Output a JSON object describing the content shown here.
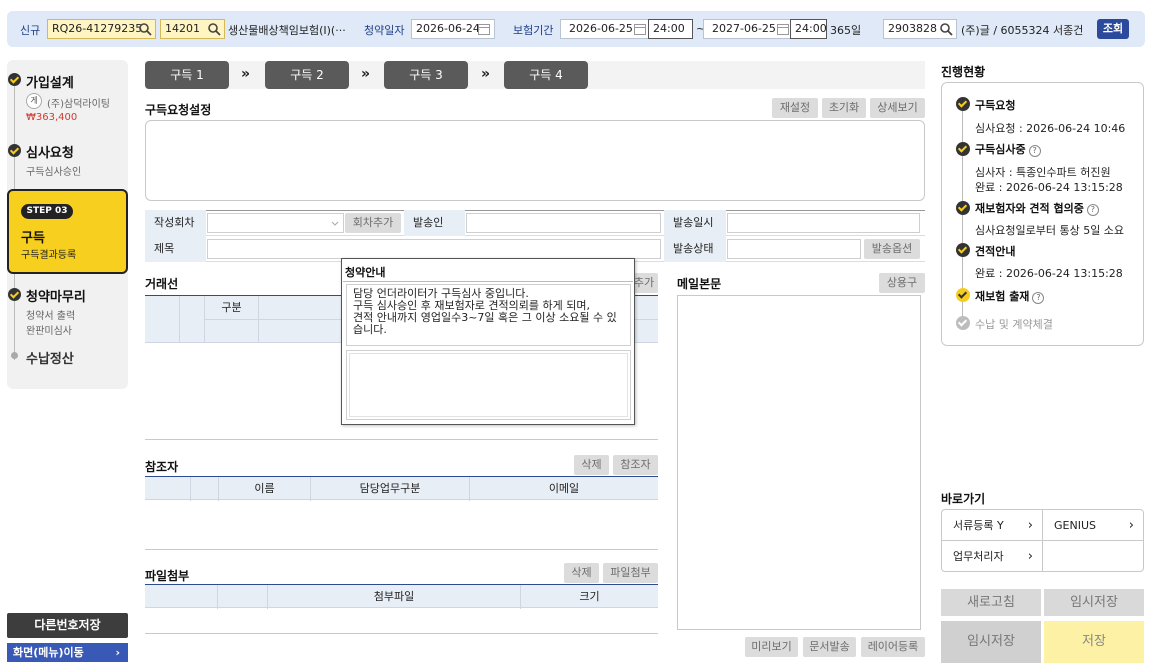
{
  "topbar": {
    "new_label": "신규",
    "case_no": "RQ26-41279235",
    "code": "14201",
    "product": "생산물배상책임보험(I)(···",
    "subscribe_date_label": "청약일자",
    "subscribe_date": "2026-06-24",
    "period_label": "보험기간",
    "period_start": "2026-06-25",
    "period_start_time": "24:00",
    "tilde": "~",
    "period_end": "2027-06-25",
    "period_end_time": "24:00",
    "days": "365일",
    "customer_code": "2903828",
    "customer_name": "(주)글 / 6055324 서종건",
    "query_button": "조회"
  },
  "steps": {
    "s1": {
      "title": "가입설계",
      "badge": "게",
      "company": "(주)삼덕라이팅",
      "amount": "₩363,400"
    },
    "s2": {
      "title": "심사요청",
      "sub": "구득심사승인"
    },
    "s3": {
      "badge": "STEP 03",
      "title": "구득",
      "sub": "구득결과등록"
    },
    "s4": {
      "title": "청약마무리",
      "sub1": "청약서 출력",
      "sub2": "완판미심사"
    },
    "s5": {
      "title": "수납정산"
    }
  },
  "left_buttons": {
    "save_other": "다른번호저장",
    "menu_move": "화면(메뉴)이동",
    "chevron": "›"
  },
  "tabs": [
    "구득 1",
    "구득 2",
    "구득 3",
    "구득 4"
  ],
  "tab_arrow": "»",
  "request": {
    "title": "구득요청설정",
    "buttons": [
      "재설정",
      "초기화",
      "상세보기"
    ]
  },
  "form": {
    "round_label": "작성회차",
    "add_round": "회차추가",
    "sender_label": "발송인",
    "send_date_label": "발송일시",
    "subject_label": "제목",
    "send_status_label": "발송상태",
    "send_option": "발송옵션"
  },
  "counterpart": {
    "title": "거래선",
    "add_button": "추가",
    "col_type": "구분"
  },
  "mail": {
    "title": "메일본문",
    "phrase_button": "상용구"
  },
  "reference": {
    "title": "참조자",
    "delete": "삭제",
    "add": "참조자",
    "cols": [
      "이름",
      "담당업무구분",
      "이메일"
    ]
  },
  "attach": {
    "title": "파일첨부",
    "delete": "삭제",
    "add": "파일첨부",
    "cols": [
      "첨부파일",
      "크기"
    ]
  },
  "bottom_buttons": [
    "미리보기",
    "문서발송",
    "레이어등록"
  ],
  "popup": {
    "title": "청약안내",
    "message": "담당 언더라이터가 구득심사 중입니다.\n구득 심사승인 후 재보험자로 견적의뢰를 하게 되며,\n견적 안내까지 영업일수3~7일 혹은 그 이상 소요될 수 있습니다."
  },
  "progress": {
    "title": "진행현황",
    "items": [
      {
        "title": "구득요청",
        "lines": [
          "심사요청 : 2026-06-24 10:46"
        ]
      },
      {
        "title": "구득심사중",
        "lines": [
          "심사자 : 특종인수파트 허진원",
          "완료 : 2026-06-24 13:15:28"
        ]
      },
      {
        "title": "재보험자와 견적 협의중",
        "lines": [
          "심사요청일로부터 통상 5일 소요"
        ]
      },
      {
        "title": "견적안내",
        "lines": [
          "완료 : 2026-06-24 13:15:28"
        ]
      },
      {
        "title": "재보험 출재",
        "lines": []
      },
      {
        "title": "수납 및 계약체결",
        "lines": []
      }
    ],
    "help": "?"
  },
  "shortcuts": {
    "title": "바로가기",
    "items": [
      "서류등록 Y",
      "GENIUS",
      "업무처리자"
    ],
    "chevron": "›"
  },
  "actions": {
    "refresh": "새로고침",
    "temp_save1": "임시저장",
    "temp_save2": "임시저장",
    "save": "저장"
  },
  "colors": {
    "accent_yellow": "#f7cf1e",
    "nav_blue": "#3859b6",
    "topbar_bg": "#dfe9f7"
  }
}
